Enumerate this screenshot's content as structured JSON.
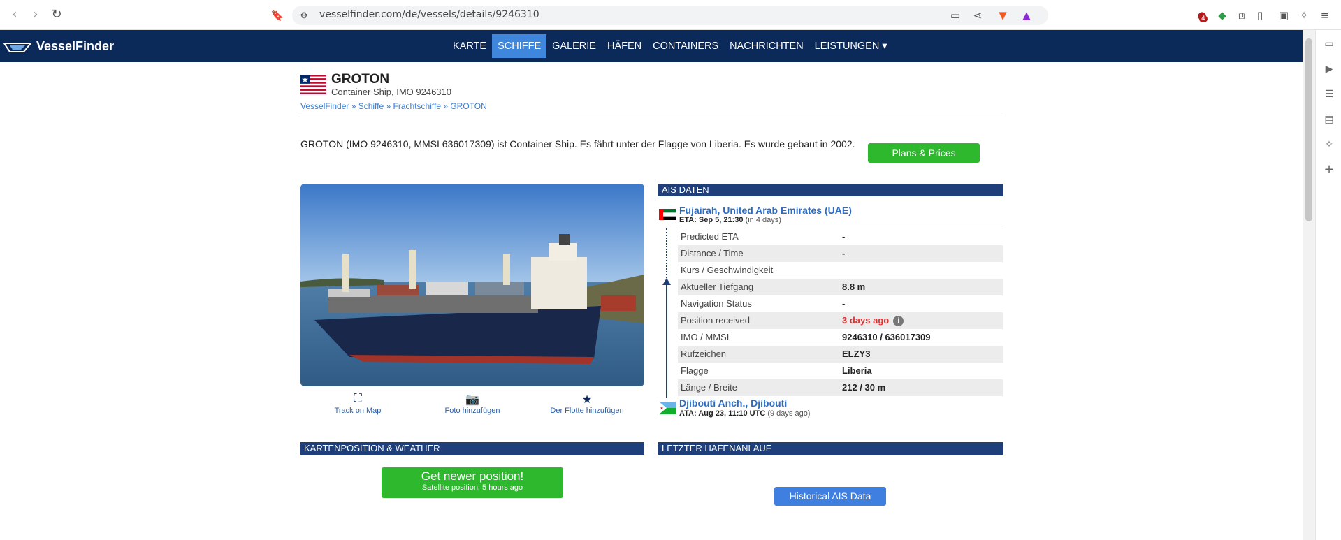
{
  "browser": {
    "url": "vesselfinder.com/de/vessels/details/9246310",
    "extension_badge": "4"
  },
  "site": {
    "logo_text": "VesselFinder",
    "nav": [
      {
        "label": "KARTE",
        "active": false
      },
      {
        "label": "SCHIFFE",
        "active": true
      },
      {
        "label": "GALERIE",
        "active": false
      },
      {
        "label": "HÄFEN",
        "active": false
      },
      {
        "label": "CONTAINERS",
        "active": false
      },
      {
        "label": "NACHRICHTEN",
        "active": false
      },
      {
        "label": "LEISTUNGEN ▾",
        "active": false
      }
    ]
  },
  "vessel": {
    "name": "GROTON",
    "subtitle": "Container Ship, IMO 9246310",
    "breadcrumb": "VesselFinder » Schiffe » Frachtschiffe » GROTON",
    "description": "GROTON (IMO 9246310, MMSI 636017309) ist Container Ship. Es fährt unter der Flagge von Liberia. Es wurde gebaut in 2002.",
    "plans_button": "Plans & Prices"
  },
  "photo_actions": {
    "track": "Track on Map",
    "photo": "Foto hinzufügen",
    "fleet": "Der Flotte hinzufügen"
  },
  "ais": {
    "header": "AIS DATEN",
    "destination": "Fujairah, United Arab Emirates (UAE)",
    "eta_label": "ETA: Sep 5, 21:30",
    "eta_rel": "(in 4 days)",
    "rows": [
      {
        "k": "Predicted ETA",
        "v": "-"
      },
      {
        "k": "Distance / Time",
        "v": "-"
      },
      {
        "k": "Kurs / Geschwindigkeit",
        "v": ""
      },
      {
        "k": "Aktueller Tiefgang",
        "v": "8.8 m"
      },
      {
        "k": "Navigation Status",
        "v": "-"
      },
      {
        "k": "Position received",
        "v": "3 days ago"
      },
      {
        "k": "IMO / MMSI",
        "v": "9246310 / 636017309"
      },
      {
        "k": "Rufzeichen",
        "v": "ELZY3"
      },
      {
        "k": "Flagge",
        "v": "Liberia"
      },
      {
        "k": "Länge / Breite",
        "v": "212 / 30 m"
      }
    ],
    "origin": "Djibouti Anch., Djibouti",
    "ata_label": "ATA: Aug 23, 11:10 UTC",
    "ata_rel": "(9 days ago)"
  },
  "sections": {
    "map_header": "KARTENPOSITION & WEATHER",
    "port_header": "LETZTER HAFENANLAUF",
    "newer_l1": "Get newer position!",
    "newer_l2": "Satellite position: 5 hours ago",
    "hist_button": "Historical AIS Data"
  },
  "colors": {
    "nav_bg": "#0c2a59",
    "accent_blue": "#3f87dd",
    "green": "#2eb82e",
    "section_blue": "#1e3f7a",
    "warning_red": "#e03030"
  }
}
